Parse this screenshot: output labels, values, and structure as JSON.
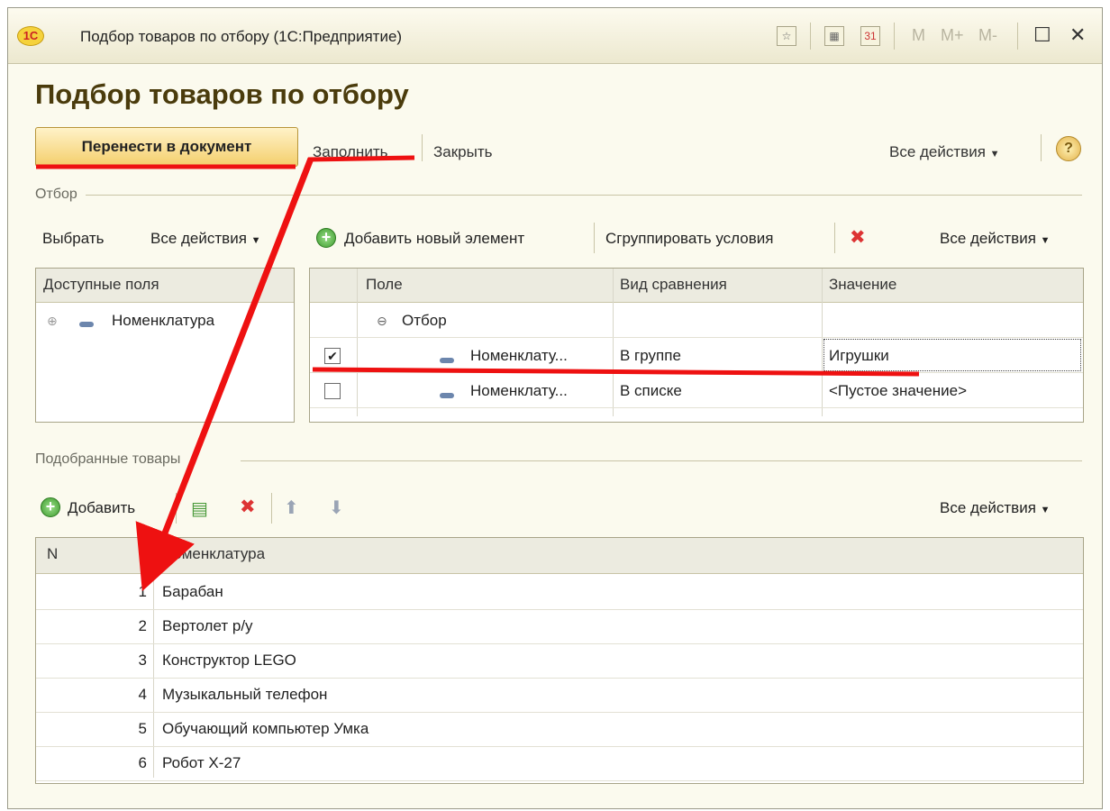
{
  "window": {
    "title": "Подбор товаров по отбору  (1С:Предприятие)",
    "logo": "1С",
    "memory_buttons": [
      "M",
      "M+",
      "M-"
    ]
  },
  "form": {
    "title": "Подбор товаров по отбору"
  },
  "command_bar": {
    "primary": "Перенести в документ",
    "fill": "Заполнить",
    "close": "Закрыть",
    "all_actions": "Все действия",
    "help": "?"
  },
  "filter": {
    "section_label": "Отбор",
    "choose": "Выбрать",
    "left_all_actions": "Все действия",
    "add_new": "Добавить новый элемент",
    "group_conditions": "Сгруппировать условия",
    "right_all_actions": "Все действия",
    "available_fields_header": "Доступные поля",
    "available_fields": [
      "Номенклатура"
    ],
    "columns": [
      "Поле",
      "Вид сравнения",
      "Значение"
    ],
    "group_row": "Отбор",
    "rows": [
      {
        "checked": true,
        "field": "Номенклату...",
        "comparison": "В группе",
        "value": "Игрушки"
      },
      {
        "checked": false,
        "field": "Номенклату...",
        "comparison": "В списке",
        "value": "<Пустое значение>"
      }
    ]
  },
  "goods": {
    "section_label": "Подобранные товары",
    "add": "Добавить",
    "all_actions": "Все действия",
    "columns": [
      "N",
      "Номенклатура"
    ],
    "rows": [
      {
        "n": "1",
        "name": "Барабан"
      },
      {
        "n": "2",
        "name": "Вертолет р/у"
      },
      {
        "n": "3",
        "name": "Конструктор LEGO"
      },
      {
        "n": "4",
        "name": "Музыкальный телефон"
      },
      {
        "n": "5",
        "name": "Обучающий компьютер Умка"
      },
      {
        "n": "6",
        "name": "Робот Х-27"
      }
    ]
  },
  "colors": {
    "annotation": "#ee1111",
    "title_brown": "#4a3b0c",
    "window_bg": "#fbfaee"
  }
}
